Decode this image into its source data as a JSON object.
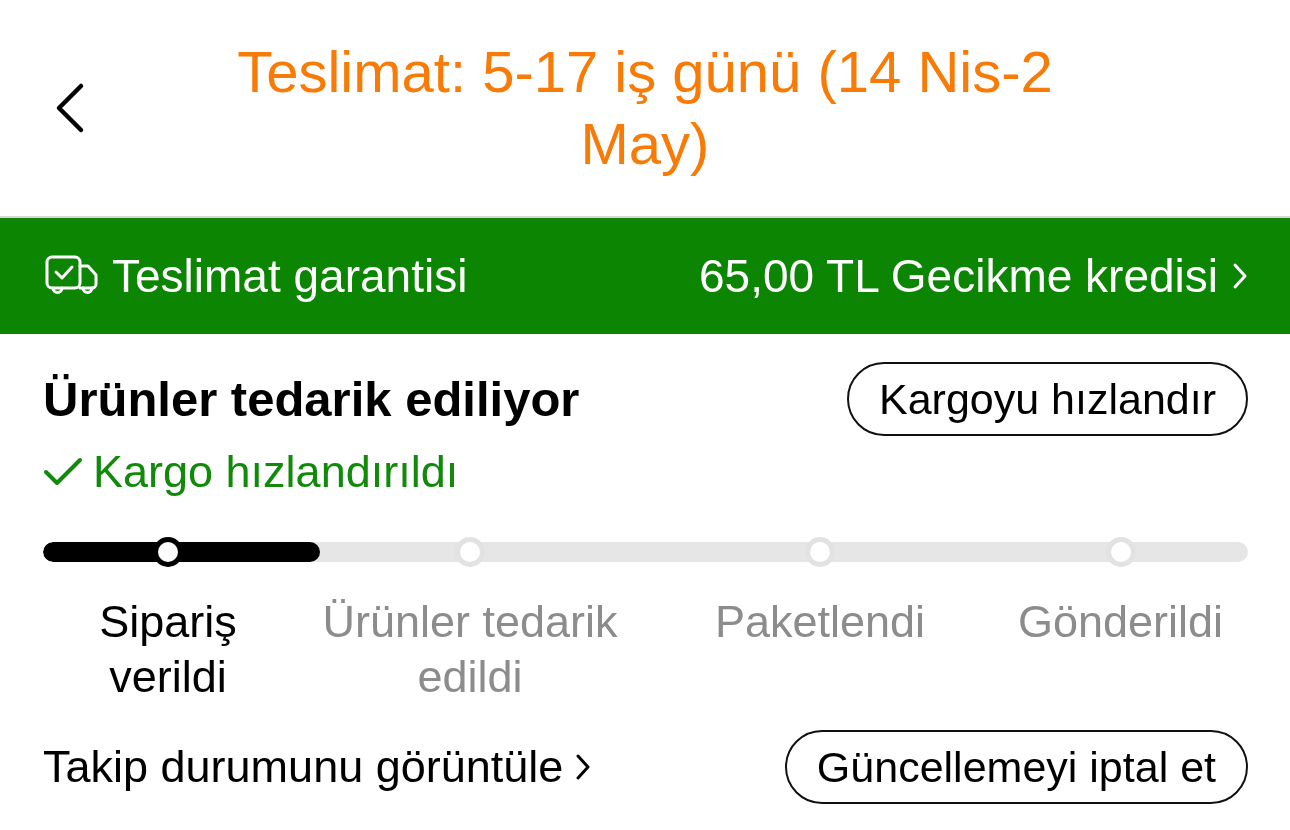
{
  "header": {
    "title": "Teslimat: 5-17 iş günü (14 Nis-2 May)"
  },
  "guarantee_bar": {
    "label": "Teslimat garantisi",
    "credit": "65,00 TL Gecikme kredisi"
  },
  "status": {
    "title": "Ürünler tedarik ediliyor",
    "action": "Kargoyu hızlandır",
    "note": "Kargo hızlandırıldı"
  },
  "progress": {
    "level": 0.23,
    "steps": [
      {
        "label": "Sipariş verildi",
        "reached": true
      },
      {
        "label": "Ürünler tedarik edildi",
        "reached": false
      },
      {
        "label": "Paketlendi",
        "reached": false
      },
      {
        "label": "Gönderildi",
        "reached": false
      }
    ]
  },
  "footer": {
    "tracking_link": "Takip durumunu görüntüle",
    "cancel_button": "Güncellemeyi iptal et"
  }
}
